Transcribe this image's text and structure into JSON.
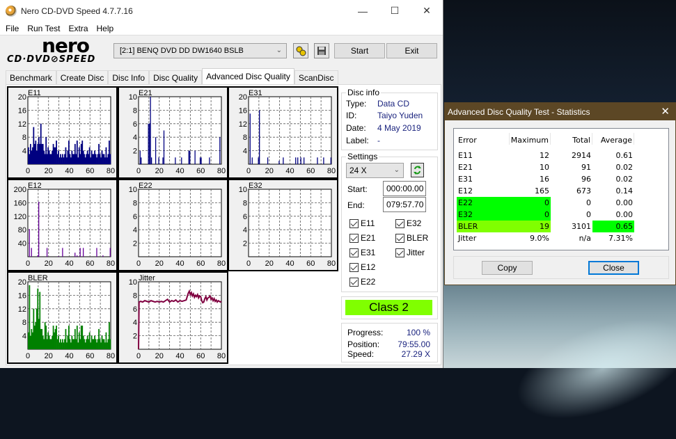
{
  "window": {
    "title": "Nero CD-DVD Speed 4.7.7.16",
    "minimize": "—",
    "maximize": "☐",
    "close": "✕"
  },
  "menu": [
    "File",
    "Run Test",
    "Extra",
    "Help"
  ],
  "logo": {
    "top": "nero",
    "bottom": "CD·DVD⊘SPEED"
  },
  "toolbar": {
    "drive": "[2:1]  BENQ DVD DD DW1640 BSLB",
    "start_label": "Start",
    "exit_label": "Exit"
  },
  "tabs": [
    "Benchmark",
    "Create Disc",
    "Disc Info",
    "Disc Quality",
    "Advanced Disc Quality",
    "ScanDisc"
  ],
  "active_tab": "Advanced Disc Quality",
  "disc_info": {
    "label": "Disc info",
    "type_label": "Type:",
    "type": "Data CD",
    "id_label": "ID:",
    "id": "Taiyo Yuden",
    "date_label": "Date:",
    "date": "4 May 2019",
    "disc_label_label": "Label:",
    "disc_label": "-"
  },
  "settings": {
    "label": "Settings",
    "speed": "24 X",
    "start_label": "Start:",
    "start": "000:00.00",
    "end_label": "End:",
    "end": "079:57.70",
    "checkboxes": [
      {
        "label": "E11",
        "checked": true
      },
      {
        "label": "E32",
        "checked": true
      },
      {
        "label": "E21",
        "checked": true
      },
      {
        "label": "BLER",
        "checked": true
      },
      {
        "label": "E31",
        "checked": true
      },
      {
        "label": "Jitter",
        "checked": true
      },
      {
        "label": "E12",
        "checked": true
      },
      {
        "label": "E22",
        "checked": true
      }
    ]
  },
  "class_badge": {
    "label": "Class 2",
    "color": "#80ff00"
  },
  "progress": {
    "progress_label": "Progress:",
    "progress": "100 %",
    "position_label": "Position:",
    "position": "79:55.00",
    "speed_label": "Speed:",
    "speed": "27.29 X"
  },
  "stats_dialog": {
    "title": "Advanced Disc Quality Test - Statistics",
    "headers": [
      "Error",
      "Maximum",
      "Total",
      "Average"
    ],
    "rows": [
      {
        "name": "E11",
        "max": "12",
        "total": "2914",
        "avg": "0.61",
        "hl_left": "",
        "hl_avg": ""
      },
      {
        "name": "E21",
        "max": "10",
        "total": "91",
        "avg": "0.02",
        "hl_left": "",
        "hl_avg": ""
      },
      {
        "name": "E31",
        "max": "16",
        "total": "96",
        "avg": "0.02",
        "hl_left": "",
        "hl_avg": ""
      },
      {
        "name": "E12",
        "max": "165",
        "total": "673",
        "avg": "0.14",
        "hl_left": "",
        "hl_avg": ""
      },
      {
        "name": "E22",
        "max": "0",
        "total": "0",
        "avg": "0.00",
        "hl_left": "#00ff00",
        "hl_avg": ""
      },
      {
        "name": "E32",
        "max": "0",
        "total": "0",
        "avg": "0.00",
        "hl_left": "#00ff00",
        "hl_avg": ""
      },
      {
        "name": "BLER",
        "max": "19",
        "total": "3101",
        "avg": "0.65",
        "hl_left": "#80ff00",
        "hl_avg": "#00ff00"
      },
      {
        "name": "Jitter",
        "max": "9.0%",
        "total": "n/a",
        "avg": "7.31%",
        "hl_left": "",
        "hl_avg": ""
      }
    ],
    "copy_label": "Copy",
    "close_label": "Close"
  },
  "chart_data": [
    {
      "type": "bar",
      "title": "E11",
      "color": "#000080",
      "xlim": [
        0,
        80
      ],
      "ylim": [
        0,
        20
      ],
      "xticks": [
        0,
        20,
        40,
        60,
        80
      ],
      "yticks": [
        4,
        8,
        12,
        16,
        20
      ],
      "grid": true,
      "x": [
        0,
        1,
        2,
        3,
        4,
        5,
        6,
        7,
        8,
        9,
        10,
        11,
        12,
        13,
        14,
        15,
        16,
        17,
        18,
        19,
        20,
        21,
        22,
        23,
        24,
        25,
        26,
        27,
        28,
        29,
        30,
        31,
        32,
        33,
        34,
        35,
        36,
        37,
        38,
        39,
        40,
        41,
        42,
        43,
        44,
        45,
        46,
        47,
        48,
        49,
        50,
        51,
        52,
        53,
        54,
        55,
        56,
        57,
        58,
        59,
        60,
        61,
        62,
        63,
        64,
        65,
        66,
        67,
        68,
        69,
        70,
        71,
        72,
        73,
        74,
        75,
        76,
        77,
        78,
        79
      ],
      "values": [
        5,
        3,
        6,
        4,
        5,
        11,
        6,
        7,
        4,
        6,
        8,
        6,
        12,
        6,
        6,
        4,
        3,
        8,
        3,
        5,
        4,
        3,
        3,
        4,
        6,
        5,
        5,
        7,
        3,
        4,
        2,
        3,
        2,
        3,
        2,
        3,
        5,
        2,
        4,
        7,
        3,
        2,
        4,
        3,
        3,
        6,
        3,
        7,
        2,
        5,
        3,
        6,
        7,
        4,
        3,
        2,
        3,
        4,
        3,
        5,
        2,
        4,
        3,
        3,
        4,
        3,
        2,
        3,
        6,
        3,
        2,
        4,
        3,
        3,
        2,
        5,
        2,
        3,
        7,
        3
      ]
    },
    {
      "type": "bar",
      "title": "E21",
      "color": "#000080",
      "xlim": [
        0,
        80
      ],
      "ylim": [
        0,
        10
      ],
      "xticks": [
        0,
        20,
        40,
        60,
        80
      ],
      "yticks": [
        2,
        4,
        6,
        8,
        10
      ],
      "grid": true,
      "x": [
        1,
        2,
        9,
        10,
        11,
        12,
        16,
        19,
        23,
        24,
        35,
        41,
        48,
        49,
        54,
        59,
        60,
        68,
        78
      ],
      "values": [
        2,
        1,
        6,
        6,
        10,
        1,
        4,
        1,
        1,
        5,
        1,
        1,
        2,
        2,
        2,
        1,
        1,
        1,
        4
      ]
    },
    {
      "type": "bar",
      "title": "E31",
      "color": "#000080",
      "xlim": [
        0,
        80
      ],
      "ylim": [
        0,
        20
      ],
      "xticks": [
        0,
        20,
        40,
        60,
        80
      ],
      "yticks": [
        4,
        8,
        12,
        16,
        20
      ],
      "grid": true,
      "x": [
        1,
        3,
        9,
        10,
        18,
        29,
        33,
        45,
        47,
        50,
        53,
        66,
        72,
        79
      ],
      "values": [
        15,
        2,
        2,
        16,
        2,
        1,
        2,
        2,
        2,
        2,
        2,
        2,
        2,
        2
      ]
    },
    {
      "type": "bar",
      "title": "E12",
      "color": "#660099",
      "xlim": [
        0,
        80
      ],
      "ylim": [
        0,
        200
      ],
      "xticks": [
        0,
        20,
        40,
        60,
        80
      ],
      "yticks": [
        40,
        80,
        120,
        160,
        200
      ],
      "grid": true,
      "x": [
        1,
        3,
        9,
        10,
        18,
        29,
        33,
        45,
        47,
        50,
        53,
        66,
        72,
        79
      ],
      "values": [
        82,
        26,
        4,
        163,
        26,
        2,
        26,
        12,
        4,
        26,
        26,
        26,
        4,
        26
      ]
    },
    {
      "type": "bar",
      "title": "E22",
      "color": "#000080",
      "xlim": [
        0,
        80
      ],
      "ylim": [
        0,
        10
      ],
      "xticks": [
        0,
        20,
        40,
        60,
        80
      ],
      "yticks": [
        2,
        4,
        6,
        8,
        10
      ],
      "grid": true,
      "x": [],
      "values": []
    },
    {
      "type": "bar",
      "title": "E32",
      "color": "#000080",
      "xlim": [
        0,
        80
      ],
      "ylim": [
        0,
        10
      ],
      "xticks": [
        0,
        20,
        40,
        60,
        80
      ],
      "yticks": [
        2,
        4,
        6,
        8,
        10
      ],
      "grid": true,
      "x": [],
      "values": []
    },
    {
      "type": "bar",
      "title": "BLER",
      "color": "#008000",
      "xlim": [
        0,
        80
      ],
      "ylim": [
        0,
        20
      ],
      "xticks": [
        0,
        20,
        40,
        60,
        80
      ],
      "yticks": [
        4,
        8,
        12,
        16,
        20
      ],
      "grid": true,
      "x": [
        0,
        1,
        2,
        3,
        4,
        5,
        6,
        7,
        8,
        9,
        10,
        11,
        12,
        13,
        14,
        15,
        16,
        17,
        18,
        19,
        20,
        21,
        22,
        23,
        24,
        25,
        26,
        27,
        28,
        29,
        30,
        31,
        32,
        33,
        34,
        35,
        36,
        37,
        38,
        39,
        40,
        41,
        42,
        43,
        44,
        45,
        46,
        47,
        48,
        49,
        50,
        51,
        52,
        53,
        54,
        55,
        56,
        57,
        58,
        59,
        60,
        61,
        62,
        63,
        64,
        65,
        66,
        67,
        68,
        69,
        70,
        71,
        72,
        73,
        74,
        75,
        76,
        77,
        78,
        79
      ],
      "values": [
        5,
        19,
        4,
        6,
        5,
        12,
        7,
        8,
        12,
        18,
        9,
        17,
        6,
        6,
        4,
        3,
        8,
        7,
        3,
        5,
        4,
        3,
        3,
        4,
        7,
        5,
        6,
        7,
        3,
        4,
        2,
        3,
        2,
        3,
        2,
        3,
        6,
        2,
        4,
        7,
        3,
        2,
        4,
        3,
        3,
        6,
        3,
        7,
        2,
        5,
        3,
        7,
        7,
        4,
        3,
        2,
        3,
        4,
        3,
        5,
        2,
        4,
        3,
        3,
        4,
        3,
        2,
        3,
        6,
        3,
        2,
        4,
        3,
        3,
        2,
        5,
        2,
        3,
        8,
        3
      ]
    },
    {
      "type": "line",
      "title": "Jitter",
      "color": "#800040",
      "xlim": [
        0,
        80
      ],
      "ylim": [
        0,
        10
      ],
      "xticks": [
        0,
        20,
        40,
        60,
        80
      ],
      "yticks": [
        2,
        4,
        6,
        8,
        10
      ],
      "grid": true,
      "x": [
        0,
        0.5,
        2,
        4,
        6,
        8,
        10,
        12,
        14,
        16,
        18,
        20,
        22,
        24,
        26,
        28,
        30,
        32,
        34,
        36,
        38,
        40,
        42,
        44,
        46,
        47,
        48,
        49,
        50,
        51,
        52,
        53,
        54,
        55,
        56,
        57,
        58,
        59,
        60,
        61,
        62,
        63,
        64,
        65,
        66,
        67,
        68,
        69,
        70,
        71,
        72,
        73,
        74,
        75,
        76,
        77,
        78,
        79,
        80
      ],
      "values": [
        0,
        7.0,
        7.1,
        7.0,
        7.2,
        7.1,
        7.0,
        7.2,
        7.1,
        7.0,
        7.1,
        7.0,
        7.1,
        7.0,
        7.2,
        7.4,
        7.0,
        7.2,
        7.1,
        7.3,
        7.0,
        7.2,
        7.1,
        7.2,
        7.3,
        7.8,
        8.3,
        8.6,
        8.1,
        8.4,
        7.9,
        8.2,
        7.7,
        8.0,
        7.8,
        8.1,
        7.6,
        7.9,
        7.8,
        7.2,
        6.9,
        7.0,
        7.5,
        7.8,
        7.3,
        7.6,
        7.7,
        7.9,
        7.4,
        7.6,
        7.2,
        7.5,
        7.1,
        7.3,
        7.0,
        7.2,
        7.1,
        7.0,
        7.1
      ]
    }
  ]
}
